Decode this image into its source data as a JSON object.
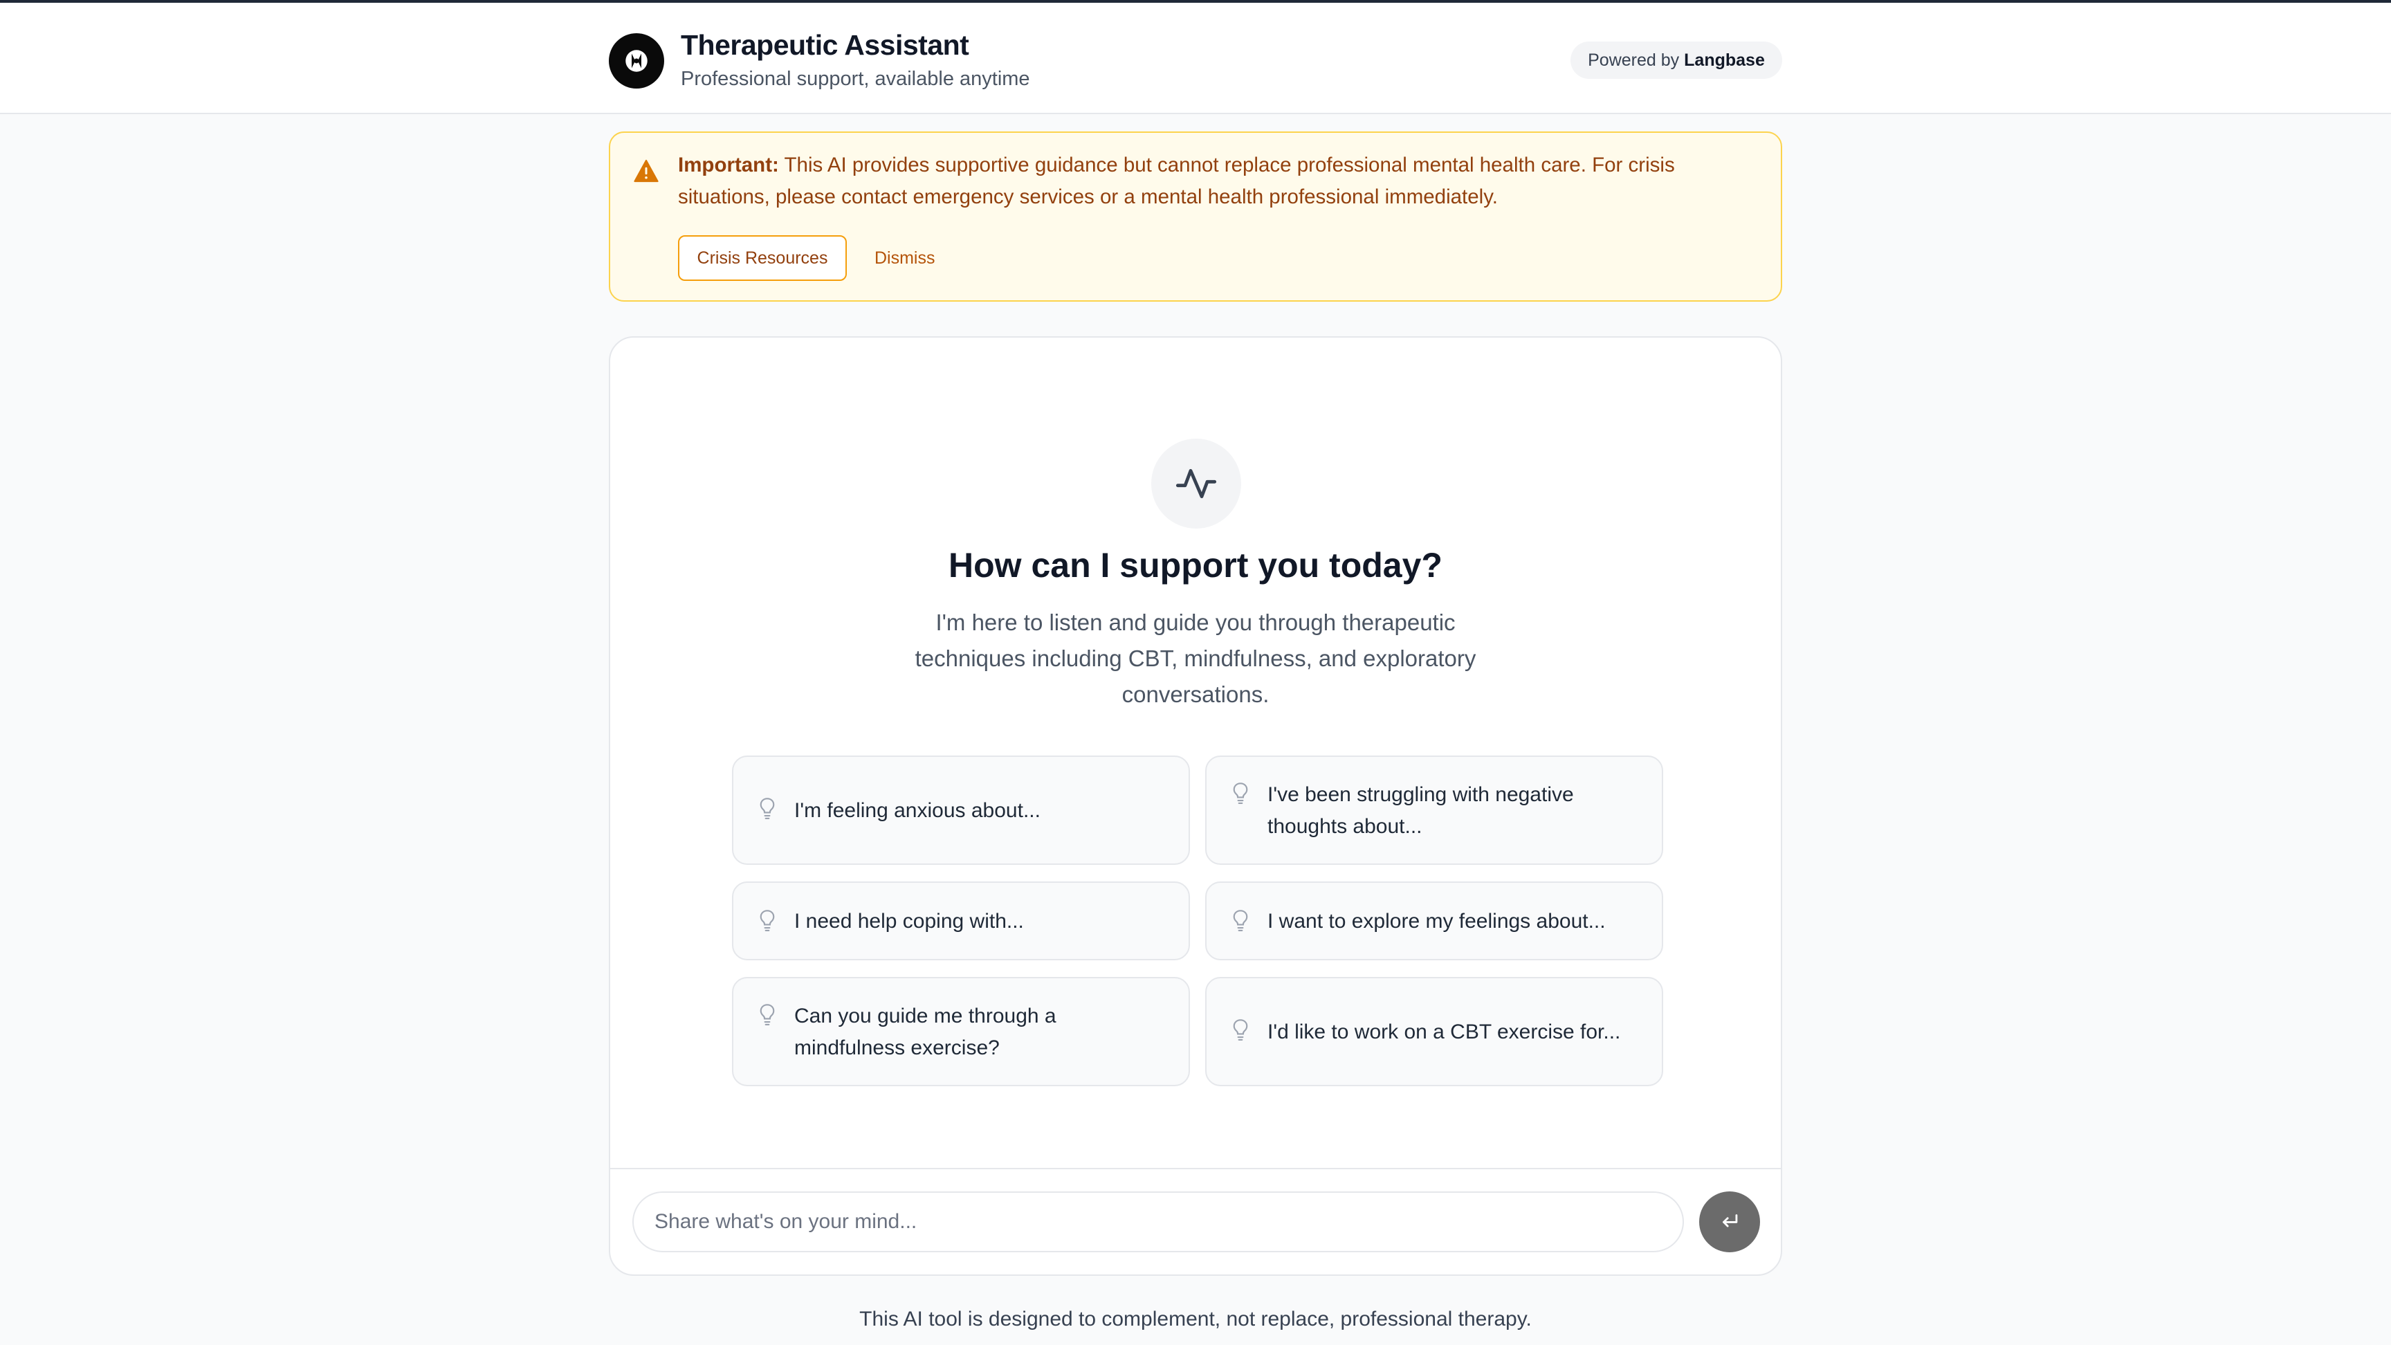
{
  "header": {
    "title": "Therapeutic Assistant",
    "subtitle": "Professional support, available anytime",
    "powered_prefix": "Powered by",
    "powered_brand": "Langbase",
    "logo_icon": "brand-logo-icon"
  },
  "alert": {
    "label": "Important:",
    "message": "This AI provides supportive guidance but cannot replace professional mental health care. For crisis situations, please contact emergency services or a mental health professional immediately.",
    "primary_button": "Crisis Resources",
    "dismiss_button": "Dismiss",
    "icon": "warning-triangle-icon",
    "color": "#92400e"
  },
  "welcome": {
    "icon": "pulse-icon",
    "title": "How can I support you today?",
    "description": "I'm here to listen and guide you through therapeutic techniques including CBT, mindfulness, and exploratory conversations."
  },
  "suggestions": [
    {
      "text": "I'm feeling anxious about..."
    },
    {
      "text": "I've been struggling with negative thoughts about..."
    },
    {
      "text": "I need help coping with..."
    },
    {
      "text": "I want to explore my feelings about..."
    },
    {
      "text": "Can you guide me through a mindfulness exercise?"
    },
    {
      "text": "I'd like to work on a CBT exercise for..."
    }
  ],
  "composer": {
    "placeholder": "Share what's on your mind...",
    "value": "",
    "send_icon": "enter-return-icon"
  },
  "footer": {
    "note": "This AI tool is designed to complement, not replace, professional therapy."
  }
}
